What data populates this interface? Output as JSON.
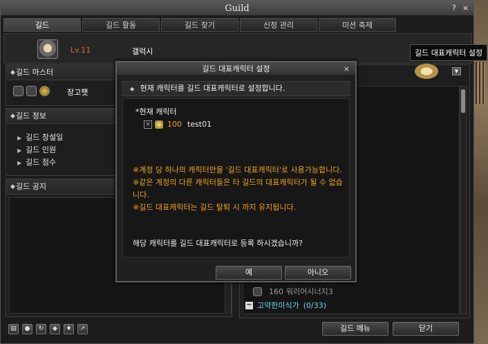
{
  "window": {
    "title": "Guild",
    "help_label": "?",
    "close_label": "×"
  },
  "tabs": [
    {
      "label": "길드"
    },
    {
      "label": "길드 활동"
    },
    {
      "label": "길드 찾기"
    },
    {
      "label": "신청 관리"
    },
    {
      "label": "미션 축제"
    }
  ],
  "guild": {
    "level": "Lv.11",
    "name": "갤럭시"
  },
  "tooltip": {
    "text": "길드 대표캐릭터 설정"
  },
  "master": {
    "header": "길드 마스터",
    "name": "장고팻"
  },
  "info": {
    "header": "길드 정보",
    "items": [
      {
        "label": "길드 창설일"
      },
      {
        "label": "길드 인원"
      },
      {
        "label": "길드 점수"
      }
    ]
  },
  "notice": {
    "header": "길드 공지"
  },
  "members": {
    "visible_member": {
      "level": "160",
      "name": "워러어시너지3"
    },
    "group": {
      "name": "고약한미식가",
      "count": "(0/33)"
    }
  },
  "buttons": {
    "guild_menu": "길드 메뉴",
    "close": "닫기"
  },
  "dialog": {
    "title": "길드 대표캐릭터 설정",
    "close_label": "×",
    "subtitle": "현재 캐릭터를 길드 대표캐릭터로 설정합니다.",
    "current_label": "*현재 캐릭터",
    "character": {
      "level": "100",
      "name": "test01"
    },
    "notes": [
      "※계정 당 하나의 캐릭터만을 '길드 대표캐릭터'로 사용가능합니다.",
      "※같은 계정의 다른 캐릭터들은 타 길드의 대표캐릭터가 될 수 없습니다.",
      "※길드 대표캐릭터는 길드 탈퇴 시 까지 유지됩니다."
    ],
    "question": "해당 캐릭터를 길드 대표캐릭터로 등록 하시겠습니까?",
    "yes": "예",
    "no": "아니오"
  },
  "colors": {
    "level_orange": "#e06a3a",
    "note_orange": "#f0a020",
    "group_cyan": "#6bd3e8"
  }
}
